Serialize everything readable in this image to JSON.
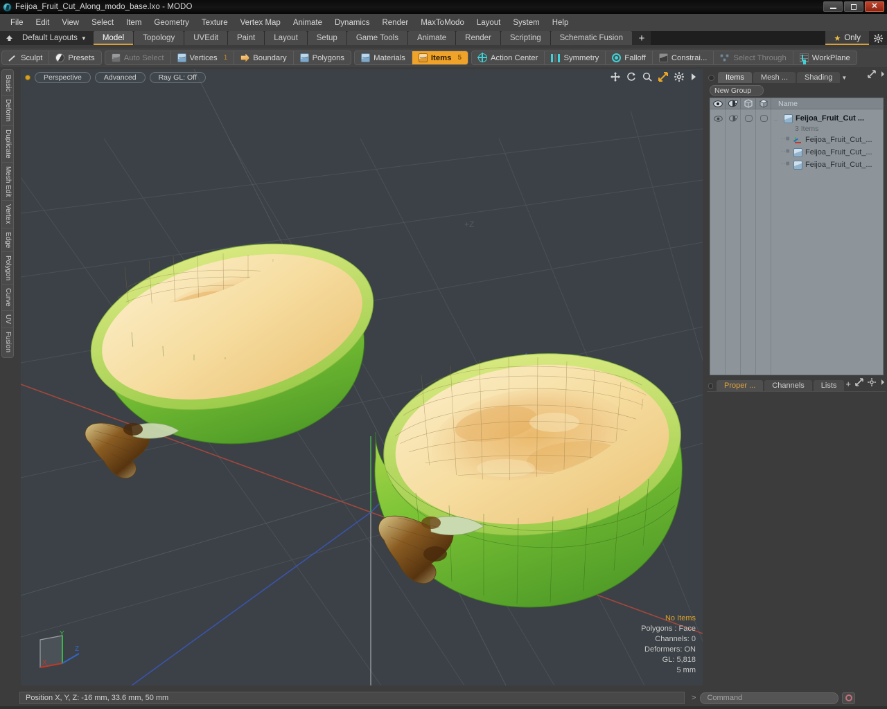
{
  "window": {
    "title": "Feijoa_Fruit_Cut_Along_modo_base.lxo - MODO",
    "app_icon": "modo-logo-icon",
    "minimize_label": "",
    "restore_label": "",
    "close_label": "✕"
  },
  "menubar": {
    "items": [
      {
        "label": "File"
      },
      {
        "label": "Edit"
      },
      {
        "label": "View"
      },
      {
        "label": "Select"
      },
      {
        "label": "Item"
      },
      {
        "label": "Geometry"
      },
      {
        "label": "Texture"
      },
      {
        "label": "Vertex Map"
      },
      {
        "label": "Animate"
      },
      {
        "label": "Dynamics"
      },
      {
        "label": "Render"
      },
      {
        "label": "MaxToModo"
      },
      {
        "label": "Layout"
      },
      {
        "label": "System"
      },
      {
        "label": "Help"
      }
    ]
  },
  "layoutbar": {
    "layouts_label": "Default Layouts",
    "caret": "▼",
    "tabs": [
      {
        "label": "Model",
        "active": true
      },
      {
        "label": "Topology",
        "active": false
      },
      {
        "label": "UVEdit",
        "active": false
      },
      {
        "label": "Paint",
        "active": false
      },
      {
        "label": "Layout",
        "active": false
      },
      {
        "label": "Setup",
        "active": false
      },
      {
        "label": "Game Tools",
        "active": false
      },
      {
        "label": "Animate",
        "active": false
      },
      {
        "label": "Render",
        "active": false
      },
      {
        "label": "Scripting",
        "active": false
      },
      {
        "label": "Schematic Fusion",
        "active": false
      }
    ],
    "add_tab_label": "+",
    "only_label": "Only",
    "only_star": "★"
  },
  "toolbar": {
    "group1": [
      {
        "label": "Sculpt",
        "icon": "sculpt-icon",
        "state": "normal"
      },
      {
        "label": "Presets",
        "icon": "presets-icon",
        "state": "normal"
      }
    ],
    "group2": [
      {
        "label": "Auto Select",
        "icon": "cube-gray-icon",
        "state": "dim",
        "count": ""
      },
      {
        "label": "Vertices",
        "icon": "cube-blue-icon",
        "state": "normal",
        "count": "1"
      },
      {
        "label": "Boundary",
        "icon": "arrow-orange-icon",
        "state": "normal",
        "count": ""
      },
      {
        "label": "Polygons",
        "icon": "cube-blue-icon",
        "state": "normal",
        "count": ""
      }
    ],
    "group3": [
      {
        "label": "Materials",
        "icon": "cube-blue-icon",
        "state": "normal",
        "count": ""
      },
      {
        "label": "Items",
        "icon": "cube-orange-icon",
        "state": "active",
        "count": "5"
      }
    ],
    "group4": [
      {
        "label": "Action Center",
        "icon": "crosshair-icon",
        "state": "normal"
      },
      {
        "label": "Symmetry",
        "icon": "symmetry-icon",
        "state": "normal"
      },
      {
        "label": "Falloff",
        "icon": "falloff-icon",
        "state": "normal"
      },
      {
        "label": "Constrai...",
        "icon": "constrain-icon",
        "state": "normal"
      },
      {
        "label": "Select Through",
        "icon": "select-through-icon",
        "state": "dim"
      },
      {
        "label": "WorkPlane",
        "icon": "workplane-icon",
        "state": "normal"
      }
    ]
  },
  "left_rail": {
    "tabs": [
      {
        "label": "Basic"
      },
      {
        "label": "Deform"
      },
      {
        "label": "Duplicate"
      },
      {
        "label": "Mesh Edit"
      },
      {
        "label": "Vertex"
      },
      {
        "label": "Edge"
      },
      {
        "label": "Polygon"
      },
      {
        "label": "Curve"
      },
      {
        "label": "UV"
      },
      {
        "label": "Fusion"
      }
    ]
  },
  "viewport": {
    "header_buttons": [
      {
        "label": "Perspective"
      },
      {
        "label": "Advanced"
      },
      {
        "label": "Ray GL: Off"
      }
    ],
    "tool_icons": [
      {
        "name": "pan-icon"
      },
      {
        "name": "rotate-icon"
      },
      {
        "name": "zoom-icon"
      },
      {
        "name": "fit-view-icon"
      },
      {
        "name": "gear-icon"
      },
      {
        "name": "chevron-right-icon"
      }
    ],
    "stats": {
      "selection": "No Items",
      "polygons": "Polygons : Face",
      "channels": "Channels: 0",
      "deformers": "Deformers: ON",
      "gl": "GL: 5,818",
      "grid": "5 mm"
    },
    "axis_gizmo": {
      "x": "X",
      "y": "Y",
      "z": "Z"
    },
    "scene": {
      "object": "Feijoa fruit cut in half, two halves, 3D shaded with wireframe",
      "skin_color": "#6fbf3c",
      "flesh_color": "#f6dfa4",
      "flesh_center": "#e8b96a",
      "stem_color": "#6e4518",
      "background_color": "#3b4146",
      "axis_red": "#b4453a",
      "axis_green": "#3a8f3a",
      "axis_blue": "#3a55b4"
    }
  },
  "right_panel": {
    "top_tabs": [
      {
        "label": "Items",
        "active": true
      },
      {
        "label": "Mesh ...",
        "active": false
      },
      {
        "label": "Shading",
        "active": false
      }
    ],
    "top_tab_caret": "▼",
    "new_group_label": "New Group",
    "list_columns": [
      {
        "icon": "eye-icon"
      },
      {
        "icon": "render-visibility-icon"
      },
      {
        "icon": "wireframe-cube-icon"
      },
      {
        "icon": "shaded-cube-icon"
      },
      {
        "label": "Name"
      }
    ],
    "items": [
      {
        "label": "Feijoa_Fruit_Cut ...",
        "icon": "mesh-icon",
        "indent": 0,
        "bold": true,
        "sub": "3 Items"
      },
      {
        "label": "Feijoa_Fruit_Cut_...",
        "icon": "locator-icon",
        "indent": 1,
        "bold": false,
        "sub": ""
      },
      {
        "label": "Feijoa_Fruit_Cut_...",
        "icon": "mesh-icon",
        "indent": 1,
        "bold": false,
        "sub": ""
      },
      {
        "label": "Feijoa_Fruit_Cut_...",
        "icon": "mesh-icon",
        "indent": 1,
        "bold": false,
        "sub": ""
      }
    ],
    "bottom_tabs": [
      {
        "label": "Proper ...",
        "active": true
      },
      {
        "label": "Channels",
        "active": false
      },
      {
        "label": "Lists",
        "active": false
      }
    ],
    "bottom_add_label": "+"
  },
  "statusbar": {
    "position_label": "Position X, Y, Z:   -16 mm, 33.6 mm, 50 mm",
    "command_chevron": ">",
    "command_placeholder": "Command",
    "record_icon": "record-icon"
  },
  "colors": {
    "accent_orange": "#f0a32a",
    "amber_text": "#e0a32c",
    "panel_bg": "#3c3c3c",
    "viewport_bg": "#3b4146",
    "list_bg": "#8d959b"
  }
}
